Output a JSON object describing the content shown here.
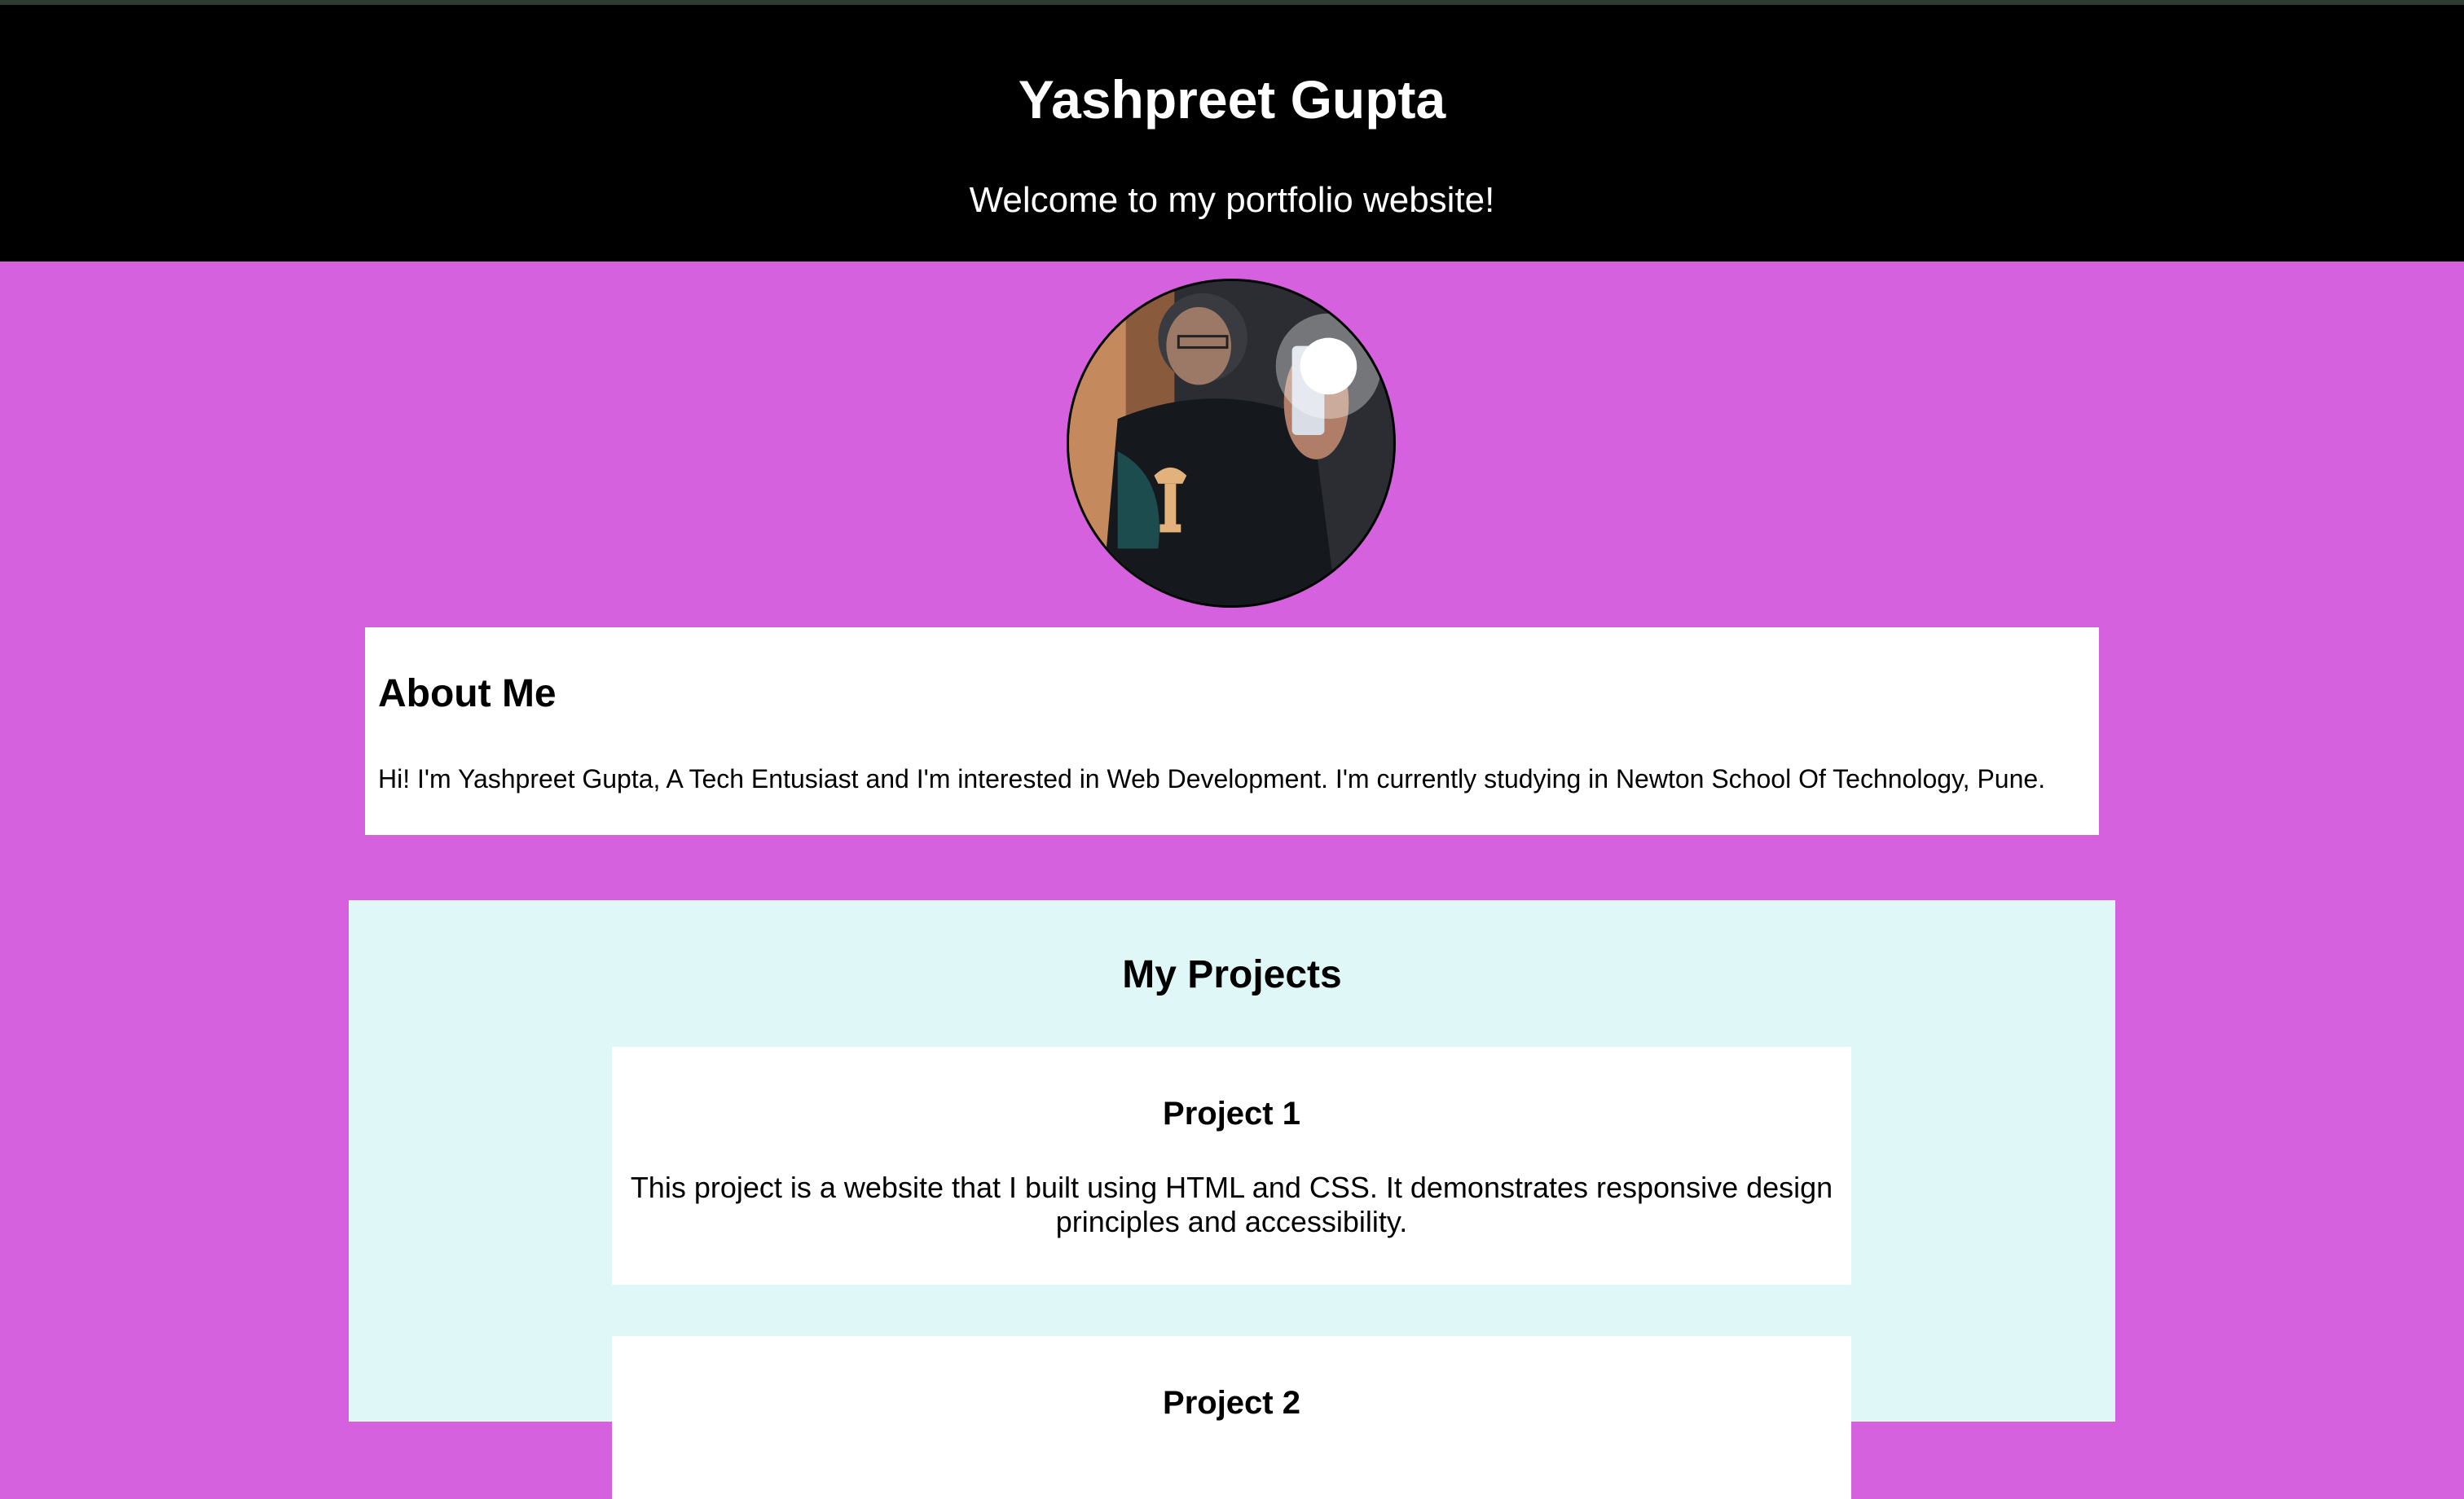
{
  "header": {
    "title": "Yashpreet Gupta",
    "subtitle": "Welcome to my portfolio website!"
  },
  "avatar": {
    "icon": "profile-photo"
  },
  "about": {
    "heading": "About Me",
    "text": "Hi! I'm Yashpreet Gupta, A Tech Entusiast and I'm interested in Web Development. I'm currently studying in Newton School Of Technology, Pune."
  },
  "projects": {
    "heading": "My Projects",
    "items": [
      {
        "title": "Project 1",
        "description": "This project is a website that I built using HTML and CSS. It demonstrates responsive design principles and accessibility."
      },
      {
        "title": "Project 2"
      }
    ]
  },
  "colors": {
    "page_bg": "#d561df",
    "header_bg": "#000000",
    "projects_bg": "#dff7f7",
    "card_bg": "#ffffff"
  }
}
